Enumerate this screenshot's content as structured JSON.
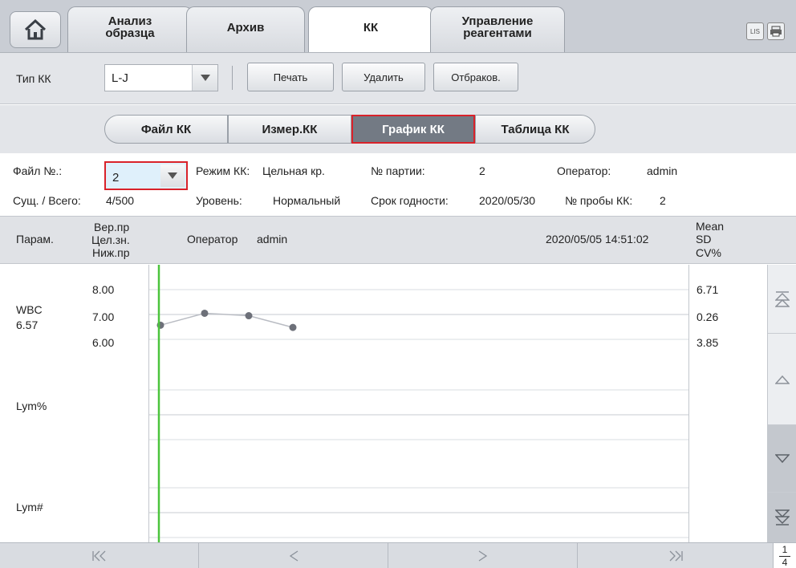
{
  "top_tabs": [
    {
      "label_line1": "Анализ",
      "label_line2": "образца"
    },
    {
      "label_line1": "Архив",
      "label_line2": ""
    },
    {
      "label_line1": "КК",
      "label_line2": ""
    },
    {
      "label_line1": "Управление",
      "label_line2": "реагентами"
    }
  ],
  "top_icons": {
    "lis": "LIS",
    "print": "printer-icon",
    "home": "home-icon"
  },
  "toolbar": {
    "qc_type_label": "Тип КК",
    "qc_type_value": "L-J",
    "print_label": "Печать",
    "delete_label": "Удалить",
    "reject_label": "Отбраков."
  },
  "seg_tabs": [
    "Файл КК",
    "Измер.КК",
    "График КК",
    "Таблица КК"
  ],
  "info": {
    "file_no_label": "Файл №.:",
    "file_no_value": "2",
    "mode_label": "Режим КК:",
    "mode_value": "Цельная кр.",
    "lot_label": "№ партии:",
    "lot_value": "2",
    "operator_label": "Оператор:",
    "operator_value": "admin",
    "count_label": "Сущ. / Всего:",
    "count_value": "4/500",
    "level_label": "Уровень:",
    "level_value": "Нормальный",
    "expiry_label": "Срок годности:",
    "expiry_value": "2020/05/30",
    "sample_label": "№ пробы КК:",
    "sample_value": "2"
  },
  "table_header": {
    "param": "Парам.",
    "upper": "Вер.пр",
    "target": "Цел.зн.",
    "lower": "Ниж.пр",
    "operator_label": "Оператор",
    "operator_value": "admin",
    "datetime": "2020/05/05 14:51:02",
    "mean": "Mean",
    "sd": "SD",
    "cv": "CV%"
  },
  "params": [
    {
      "name": "WBC",
      "value": "6.57",
      "upper": "8.00",
      "target": "7.00",
      "lower": "6.00",
      "mean": "6.71",
      "sd": "0.26",
      "cv": "3.85"
    },
    {
      "name": "Lym%",
      "value": "",
      "upper": "",
      "target": "",
      "lower": "",
      "mean": "",
      "sd": "",
      "cv": ""
    },
    {
      "name": "Lym#",
      "value": "",
      "upper": "",
      "target": "",
      "lower": "",
      "mean": "",
      "sd": "",
      "cv": ""
    }
  ],
  "chart_data": {
    "type": "line",
    "series": [
      {
        "param": "WBC",
        "values": [
          6.57,
          7.05,
          6.95,
          6.48
        ]
      }
    ],
    "ylim": [
      6.0,
      8.0
    ]
  },
  "pager": {
    "current": "1",
    "total": "4"
  },
  "colors": {
    "accent_red": "#d9222a",
    "cursor_green": "#4cc43c",
    "point": "#6d7079"
  }
}
